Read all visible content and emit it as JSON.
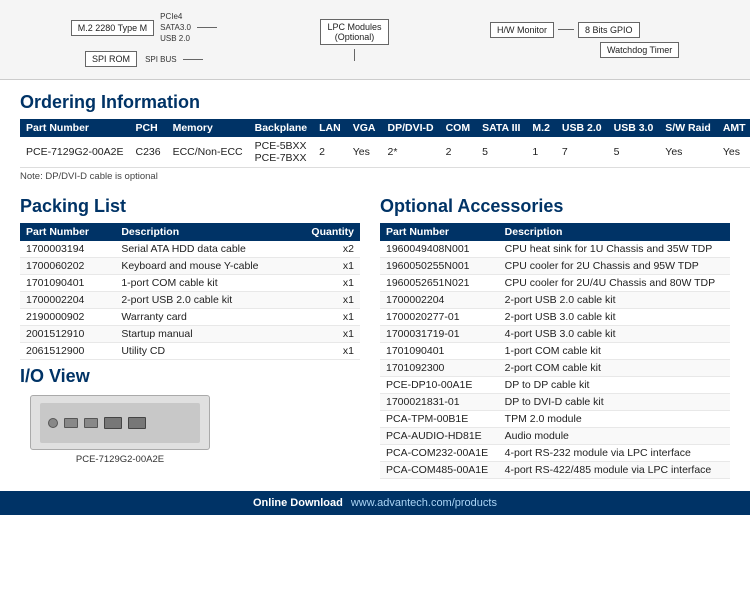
{
  "diagram": {
    "boxes": [
      {
        "label": "M.2 2280 Type M"
      },
      {
        "label": "SPI ROM"
      },
      {
        "label": "PCIe4"
      },
      {
        "label": "SATA3.0\nUSB 2.0"
      },
      {
        "label": "SPI BUS"
      },
      {
        "label": "LPC Modules\n(Optional)"
      },
      {
        "label": "H/W Monitor"
      },
      {
        "label": "8 Bits GPIO"
      },
      {
        "label": "Watchdog Timer"
      }
    ]
  },
  "ordering": {
    "title": "Ordering Information",
    "columns": [
      "Part Number",
      "PCH",
      "Memory",
      "Backplane",
      "LAN",
      "VGA",
      "DP/DVI-D",
      "COM",
      "SATA III",
      "M.2",
      "USB 2.0",
      "USB 3.0",
      "S/W Raid",
      "AMT"
    ],
    "rows": [
      {
        "part_number": "PCE-7129G2-00A2E",
        "pch": "C236",
        "memory": "ECC/Non-ECC",
        "backplane": "PCE-5BXX\nPCE-7BXX",
        "lan": "2",
        "vga": "Yes",
        "dp_dvi_d": "2*",
        "com": "2",
        "sata_iii": "5",
        "m2": "1",
        "usb_20": "7",
        "usb_30": "5",
        "sw_raid": "Yes",
        "amt": "Yes"
      }
    ],
    "note": "Note: DP/DVI-D cable is optional"
  },
  "packing_list": {
    "title": "Packing List",
    "columns": [
      "Part Number",
      "Description",
      "Quantity"
    ],
    "rows": [
      {
        "part_number": "1700003194",
        "description": "Serial ATA HDD data cable",
        "quantity": "x2"
      },
      {
        "part_number": "1700060202",
        "description": "Keyboard and mouse Y-cable",
        "quantity": "x1"
      },
      {
        "part_number": "1701090401",
        "description": "1-port COM cable kit",
        "quantity": "x1"
      },
      {
        "part_number": "1700002204",
        "description": "2-port USB 2.0 cable kit",
        "quantity": "x1"
      },
      {
        "part_number": "2190000902",
        "description": "Warranty card",
        "quantity": "x1"
      },
      {
        "part_number": "2001512910",
        "description": "Startup manual",
        "quantity": "x1"
      },
      {
        "part_number": "2061512900",
        "description": "Utility CD",
        "quantity": "x1"
      }
    ]
  },
  "optional_accessories": {
    "title": "Optional Accessories",
    "columns": [
      "Part Number",
      "Description"
    ],
    "rows": [
      {
        "part_number": "1960049408N001",
        "description": "CPU heat sink for 1U Chassis and 35W TDP"
      },
      {
        "part_number": "1960050255N001",
        "description": "CPU cooler for 2U Chassis and 95W TDP"
      },
      {
        "part_number": "1960052651N021",
        "description": "CPU cooler for 2U/4U Chassis and 80W TDP"
      },
      {
        "part_number": "1700002204",
        "description": "2-port USB 2.0 cable kit"
      },
      {
        "part_number": "1700020277-01",
        "description": "2-port USB 3.0 cable kit"
      },
      {
        "part_number": "1700031719-01",
        "description": "4-port USB 3.0 cable kit"
      },
      {
        "part_number": "1701090401",
        "description": "1-port COM cable kit"
      },
      {
        "part_number": "1701092300",
        "description": "2-port COM cable kit"
      },
      {
        "part_number": "PCE-DP10-00A1E",
        "description": "DP to DP cable kit"
      },
      {
        "part_number": "1700021831-01",
        "description": "DP to DVI-D cable kit"
      },
      {
        "part_number": "PCA-TPM-00B1E",
        "description": "TPM 2.0 module"
      },
      {
        "part_number": "PCA-AUDIO-HD81E",
        "description": "Audio module"
      },
      {
        "part_number": "PCA-COM232-00A1E",
        "description": "4-port RS-232 module via LPC interface"
      },
      {
        "part_number": "PCA-COM485-00A1E",
        "description": "4-port RS-422/485 module via LPC interface"
      }
    ]
  },
  "io_view": {
    "title": "I/O View",
    "image_label": "PCE-7129G2-00A2E"
  },
  "footer": {
    "online_label": "Online Download",
    "url": "www.advantech.com/products"
  }
}
